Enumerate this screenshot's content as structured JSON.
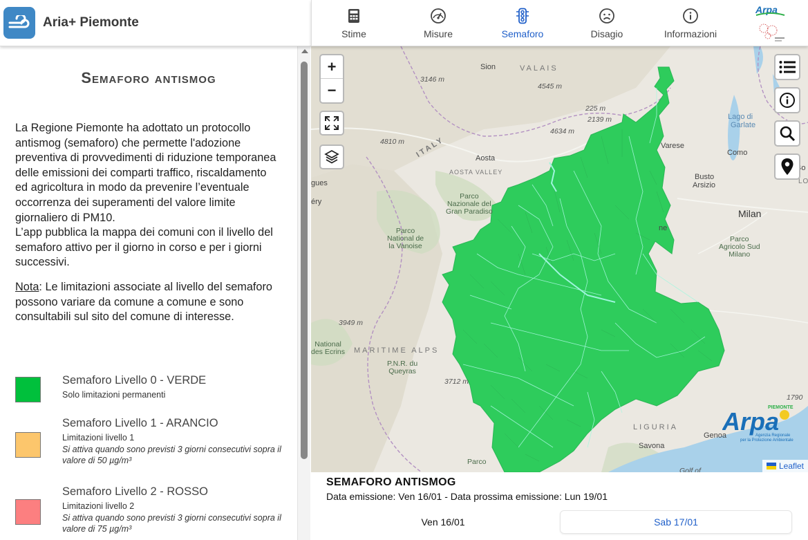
{
  "app": {
    "title": "Aria+ Piemonte"
  },
  "nav": {
    "tabs": [
      {
        "label": "Stime",
        "icon": "calculator-icon"
      },
      {
        "label": "Misure",
        "icon": "gauge-icon"
      },
      {
        "label": "Semaforo",
        "icon": "traffic-light-icon",
        "active": true
      },
      {
        "label": "Disagio",
        "icon": "sad-face-icon"
      },
      {
        "label": "Informazioni",
        "icon": "info-icon"
      }
    ],
    "brand_text": "Arpa"
  },
  "panel": {
    "title": "Semaforo antismog",
    "intro": "La Regione Piemonte ha adottato un protocollo antismog (semaforo) che permette l'adozione preventiva di provvedimenti di riduzione temporanea delle emissioni dei comparti traffico, riscaldamento ed agricoltura in modo da prevenire l’eventuale occorrenza dei superamenti del valore limite giornaliero di PM10.\nL’app pubblica la mappa dei comuni con il livello del semaforo attivo per il giorno in corso e per i giorni successivi.",
    "note_label": "Nota",
    "note_text": ": Le limitazioni associate al livello del semaforo possono variare da comune a comune e sono consultabili sul sito del comune di interesse.",
    "legend": [
      {
        "title": "Semaforo Livello 0 - VERDE",
        "subtitle": "Solo limitazioni permanenti",
        "description": "",
        "color": "#00c03c"
      },
      {
        "title": "Semaforo Livello 1 - ARANCIO",
        "subtitle": "Limitazioni livello 1",
        "description": "Si attiva quando sono previsti 3 giorni consecutivi sopra il valore di 50 µg/m³",
        "color": "#fcc66c"
      },
      {
        "title": "Semaforo Livello 2 - ROSSO",
        "subtitle": "Limitazioni livello 2",
        "description": "Si attiva quando sono previsti 3 giorni consecutivi sopra il valore di 75 µg/m³",
        "color": "#fc7f80"
      }
    ]
  },
  "map": {
    "zoom_in": "+",
    "zoom_out": "−",
    "attribution": "Leaflet",
    "region_color": "#2ecc5c",
    "logo_text": "Arpa",
    "logo_top": "PIEMONTE",
    "logo_sub1": "Agenzia Regionale",
    "logo_sub2": "per la Protezione Ambientale",
    "labels": {
      "sion": "Sion",
      "valais": "VALAIS",
      "p3146": "3146 m",
      "p4545": "4545 m",
      "p225": "225 m",
      "p2139": "2139 m",
      "p4634": "4634 m",
      "p4810": "4810 m",
      "italy": "ITALY",
      "aosta": "Aosta",
      "aosta_valley": "AOSTA VALLEY",
      "varese": "Varese",
      "como": "Como",
      "lago": "Lago di",
      "garlate": "Garlate",
      "busto": "Busto",
      "arsizio": "Arsizio",
      "milan": "Milan",
      "parco1": "Parco",
      "nazionale": "Nazionale del",
      "gran_paradiso": "Gran Paradiso",
      "parco2": "Parco",
      "naz_de": "National de",
      "vanoise": "la Vanoise",
      "parco3": "Parco",
      "agricolo": "Agricolo Sud",
      "milano": "Milano",
      "p3949": "3949 m",
      "maritime": "MARITIME ALPS",
      "pnr": "P.N.R. du",
      "queyras": "Queyras",
      "ecrins": "National",
      "des_ecrins": "des Ecrins",
      "p3712": "3712 m",
      "liguria": "LIGURIA",
      "genoa": "Genoa",
      "savona": "Savona",
      "golf": "Golf of",
      "p1790": "1790",
      "parco4": "Parco",
      "bo": "Bo",
      "lomb": "LOMB",
      "gues": "gues",
      "ery": "éry",
      "ne": "ne"
    }
  },
  "bottom": {
    "title": "SEMAFORO ANTISMOG",
    "subtitle": "Data emissione: Ven 16/01 - Data prossima emissione: Lun 19/01",
    "days": [
      "Ven 16/01",
      "Sab 17/01"
    ]
  }
}
